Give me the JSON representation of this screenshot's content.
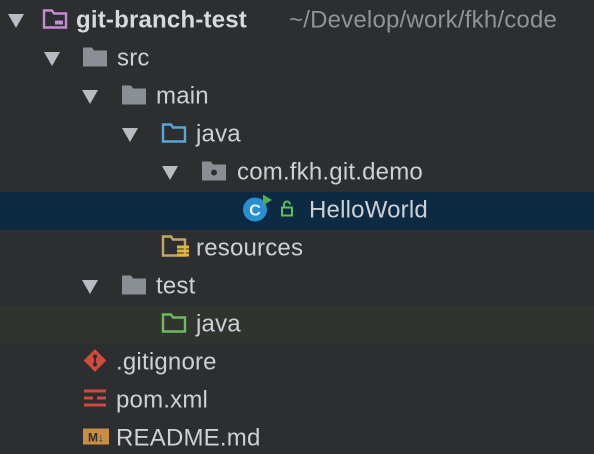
{
  "project": {
    "name": "git-branch-test",
    "path": "~/Develop/work/fkh/code"
  },
  "tree": {
    "src": "src",
    "main": "main",
    "main_java": "java",
    "package": "com.fkh.git.demo",
    "class_file": "HelloWorld",
    "resources": "resources",
    "test": "test",
    "test_java": "java",
    "gitignore": ".gitignore",
    "pom": "pom.xml",
    "readme": "README.md"
  },
  "colors": {
    "background": "#2c2e30",
    "selected_row": "#0d2a43",
    "hover_row": "#30342f",
    "project_icon": "#c58bd6",
    "folder": "#8a8f96",
    "java_source_folder": "#58a7d6",
    "test_source_folder": "#6fba5d",
    "resources_folder": "#c7a46a",
    "class_icon": "#2a8fd0",
    "git_icon": "#d04b3c",
    "maven_icon": "#d0493e",
    "markdown_icon": "#c98d45"
  },
  "icons": {
    "project": "project-folder-icon",
    "folder": "folder-icon",
    "source_folder": "source-folder-icon",
    "package": "package-icon",
    "class": "java-class-icon",
    "resources": "resources-folder-icon",
    "test_folder": "test-source-folder-icon",
    "gitignore": "git-icon",
    "maven": "maven-icon",
    "markdown": "markdown-icon"
  }
}
